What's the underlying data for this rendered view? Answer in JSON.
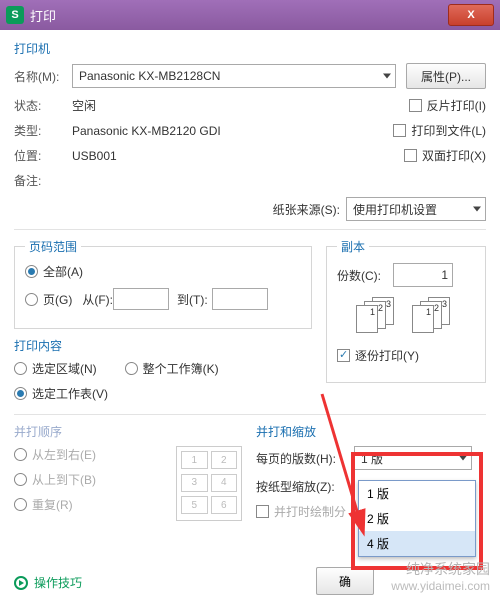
{
  "window": {
    "title": "打印",
    "icon_letter": "S"
  },
  "printer": {
    "section": "打印机",
    "name_label": "名称(M):",
    "name_value": "Panasonic KX-MB2128CN",
    "props_btn": "属性(P)...",
    "status_label": "状态:",
    "status_value": "空闲",
    "type_label": "类型:",
    "type_value": "Panasonic KX-MB2120 GDI",
    "where_label": "位置:",
    "where_value": "USB001",
    "comment_label": "备注:",
    "reverse": "反片打印(I)",
    "tofile": "打印到文件(L)",
    "duplex": "双面打印(X)",
    "source_label": "纸张来源(S):",
    "source_value": "使用打印机设置"
  },
  "range": {
    "section": "页码范围",
    "all": "全部(A)",
    "pages": "页(G)",
    "from": "从(F):",
    "to": "到(T):"
  },
  "copies": {
    "section": "副本",
    "count_label": "份数(C):",
    "count_value": "1",
    "collate": "逐份打印(Y)"
  },
  "what": {
    "section": "打印内容",
    "selection": "选定区域(N)",
    "workbook": "整个工作簿(K)",
    "sheets": "选定工作表(V)"
  },
  "order": {
    "section": "并打顺序",
    "lr": "从左到右(E)",
    "tb": "从上到下(B)",
    "repeat": "重复(R)"
  },
  "scale": {
    "section": "并打和缩放",
    "per_page": "每页的版数(H):",
    "by_paper": "按纸型缩放(Z):",
    "draw_border": "并打时绘制分",
    "selected": "1 版",
    "options": [
      "1 版",
      "2 版",
      "4 版"
    ]
  },
  "footer": {
    "tips": "操作技巧",
    "ok": "确"
  },
  "watermark": {
    "line1": "纯净系统家园",
    "line2": "www.yidaimei.com"
  }
}
